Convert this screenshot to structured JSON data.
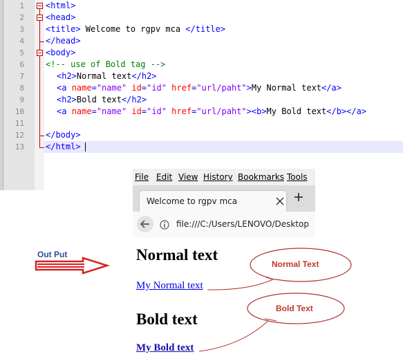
{
  "editor": {
    "line_numbers": [
      "1",
      "2",
      "3",
      "4",
      "5",
      "6",
      "7",
      "8",
      "9",
      "10",
      "11",
      "12",
      "13"
    ],
    "lines": [
      [
        {
          "c": "t-tag",
          "t": "<html>"
        }
      ],
      [
        {
          "c": "t-tag",
          "t": "<head>"
        }
      ],
      [
        {
          "c": "t-tag",
          "t": "<title>"
        },
        {
          "c": "t-text",
          "t": " Welcome to rgpv mca "
        },
        {
          "c": "t-tag",
          "t": "</title>"
        }
      ],
      [
        {
          "c": "t-tag",
          "t": "</head>"
        }
      ],
      [
        {
          "c": "t-tag",
          "t": "<body>"
        }
      ],
      [
        {
          "c": "t-com",
          "t": "<!-- use of Bold tag -->"
        }
      ],
      [
        {
          "c": "t-tag",
          "t": "<h2>"
        },
        {
          "c": "t-text",
          "t": "Normal text"
        },
        {
          "c": "t-tag",
          "t": "</h2>"
        }
      ],
      [
        {
          "c": "t-tag",
          "t": "<a "
        },
        {
          "c": "t-attr",
          "t": "name"
        },
        {
          "c": "t-tag",
          "t": "="
        },
        {
          "c": "t-val",
          "t": "\"name\""
        },
        {
          "c": "t-tag",
          "t": " "
        },
        {
          "c": "t-attr",
          "t": "id"
        },
        {
          "c": "t-tag",
          "t": "="
        },
        {
          "c": "t-val",
          "t": "\"id\""
        },
        {
          "c": "t-tag",
          "t": " "
        },
        {
          "c": "t-attr",
          "t": "href"
        },
        {
          "c": "t-tag",
          "t": "="
        },
        {
          "c": "t-val",
          "t": "\"url/paht\""
        },
        {
          "c": "t-tag",
          "t": ">"
        },
        {
          "c": "t-text",
          "t": "My Normal text"
        },
        {
          "c": "t-tag",
          "t": "</a>"
        }
      ],
      [
        {
          "c": "t-tag",
          "t": "<h2>"
        },
        {
          "c": "t-text",
          "t": "Bold text"
        },
        {
          "c": "t-tag",
          "t": "</h2>"
        }
      ],
      [
        {
          "c": "t-tag",
          "t": "<a "
        },
        {
          "c": "t-attr",
          "t": "name"
        },
        {
          "c": "t-tag",
          "t": "="
        },
        {
          "c": "t-val",
          "t": "\"name\""
        },
        {
          "c": "t-tag",
          "t": " "
        },
        {
          "c": "t-attr",
          "t": "id"
        },
        {
          "c": "t-tag",
          "t": "="
        },
        {
          "c": "t-val",
          "t": "\"id\""
        },
        {
          "c": "t-tag",
          "t": " "
        },
        {
          "c": "t-attr",
          "t": "href"
        },
        {
          "c": "t-tag",
          "t": "="
        },
        {
          "c": "t-val",
          "t": "\"url/paht\""
        },
        {
          "c": "t-tag",
          "t": "><b>"
        },
        {
          "c": "t-text",
          "t": "My Bold text"
        },
        {
          "c": "t-tag",
          "t": "</b></a>"
        }
      ],
      [],
      [
        {
          "c": "t-tag",
          "t": "</body>"
        }
      ],
      [
        {
          "c": "t-tag",
          "t": "</html>"
        }
      ]
    ],
    "colors": {
      "tag": "#0000ff",
      "attr": "#ff0000",
      "value": "#8000ff",
      "comment": "#008000",
      "fold": "#c00000",
      "current_line": "#e8e8ff"
    }
  },
  "browser": {
    "menu": [
      "File",
      "Edit",
      "View",
      "History",
      "Bookmarks",
      "Tools"
    ],
    "tab_title": "Welcome to rgpv mca",
    "url": "file:///C:/Users/LENOVO/Desktop",
    "icons": {
      "close": "close-icon",
      "new_tab": "plus-icon",
      "back": "back-arrow-icon",
      "info": "info-icon"
    }
  },
  "page": {
    "heading_normal": "Normal text",
    "link_normal": "My Normal text",
    "heading_bold": "Bold text",
    "link_bold": "My Bold text"
  },
  "annotations": {
    "output_label": "Out Put",
    "callout_normal": "Normal Text",
    "callout_bold": "Bold Text",
    "arrow_color": "#d62020",
    "callout_color": "#c0392b"
  }
}
